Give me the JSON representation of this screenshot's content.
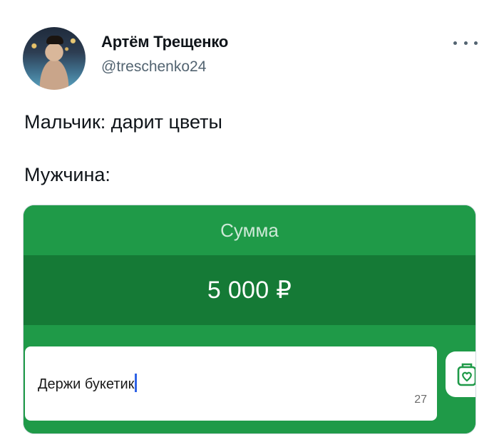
{
  "author": {
    "name": "Артём Трещенко",
    "handle": "@treschenko24"
  },
  "tweet": {
    "line1": "Мальчик: дарит цветы",
    "line2": "Мужчина:"
  },
  "transfer_card": {
    "sum_label": "Сумма",
    "amount": "5 000 ₽",
    "message_text": "Держи букетик",
    "char_counter": "27",
    "gift_icon": "gift-card-icon",
    "colors": {
      "primary_green": "#1f9a48",
      "dark_green": "#157a36",
      "caret_blue": "#2f63e6"
    }
  },
  "menu_icon": "more-dots-icon"
}
